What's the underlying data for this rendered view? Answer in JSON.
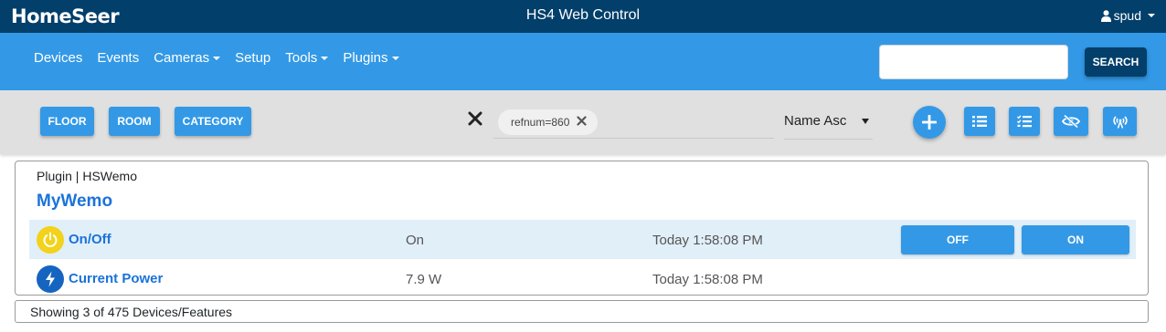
{
  "header": {
    "logo": "HomeSeer",
    "title": "HS4 Web Control",
    "user": "spud"
  },
  "nav": {
    "items": [
      {
        "label": "Devices",
        "dropdown": false
      },
      {
        "label": "Events",
        "dropdown": false
      },
      {
        "label": "Cameras",
        "dropdown": true
      },
      {
        "label": "Setup",
        "dropdown": false
      },
      {
        "label": "Tools",
        "dropdown": true
      },
      {
        "label": "Plugins",
        "dropdown": true
      }
    ],
    "search_value": "",
    "search_button": "SEARCH"
  },
  "filters": {
    "floor": "FLOOR",
    "room": "ROOM",
    "category": "CATEGORY",
    "chip": "refnum=860",
    "sort": "Name Asc"
  },
  "device": {
    "meta": "Plugin | HSWemo",
    "name": "MyWemo",
    "features": [
      {
        "name": "On/Off",
        "value": "On",
        "time": "Today 1:58:08 PM",
        "icon": "power-icon",
        "icon_color": "#f2d21b"
      },
      {
        "name": "Current Power",
        "value": "7.9 W",
        "time": "Today 1:58:08 PM",
        "icon": "lightning-icon",
        "icon_color": "#1565c0"
      }
    ],
    "controls": [
      "OFF",
      "ON"
    ]
  },
  "footer": "Showing 3 of 475 Devices/Features",
  "colors": {
    "topbar": "#023f6a",
    "navbar": "#3399e6",
    "accent_text": "#1a73d9",
    "row_highlight": "#e1eff9"
  }
}
